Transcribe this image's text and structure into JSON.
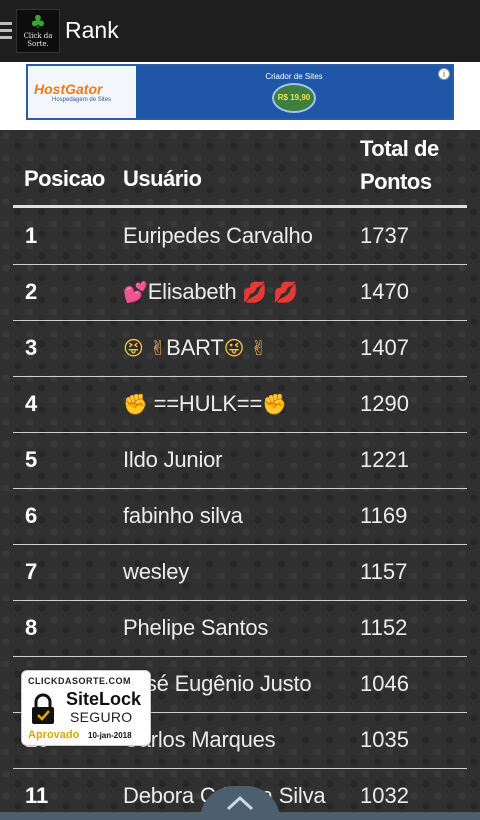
{
  "appbar": {
    "title": "Rank",
    "logo_text": "Click da Sorte."
  },
  "ad": {
    "brand": "HostGator",
    "brand_sub": "Hospedagem de Sites",
    "headline": "Criador de Sites",
    "price": "R$ 19,90"
  },
  "table": {
    "headers": {
      "position": "Posicao",
      "user": "Usuário",
      "points": "Total de Pontos"
    },
    "rows": [
      {
        "pos": "1",
        "user": "Euripedes Carvalho",
        "points": "1737"
      },
      {
        "pos": "2",
        "user": "Elisabeth",
        "points": "1470"
      },
      {
        "pos": "3",
        "user": "BART",
        "points": "1407"
      },
      {
        "pos": "4",
        "user": "==HULK==",
        "points": "1290"
      },
      {
        "pos": "5",
        "user": "Ildo Junior",
        "points": "1221"
      },
      {
        "pos": "6",
        "user": "fabinho silva",
        "points": "1169"
      },
      {
        "pos": "7",
        "user": "wesley",
        "points": "1157"
      },
      {
        "pos": "8",
        "user": "Phelipe Santos",
        "points": "1152"
      },
      {
        "pos": "9",
        "user": "José Eugênio Justo",
        "points": "1046"
      },
      {
        "pos": "10",
        "user": "Carlos Marques",
        "points": "1035"
      },
      {
        "pos": "11",
        "user": "Debora Cristina Silva",
        "points": "1032"
      }
    ]
  },
  "sitelock": {
    "top": "CLICKDASORTE.COM",
    "brand": "SiteLock",
    "sub": "SEGURO",
    "approved": "Aprovado",
    "date": "10-jan-2018"
  },
  "colors": {
    "appbar": "#1e1e1e",
    "table_bg": "#303030",
    "ad_border": "#2b5ca8",
    "scroll_button": "#4c5f6e"
  },
  "icons": [
    "menu-icon",
    "clover-icon",
    "info-icon",
    "lock-icon",
    "chevron-up-icon"
  ]
}
